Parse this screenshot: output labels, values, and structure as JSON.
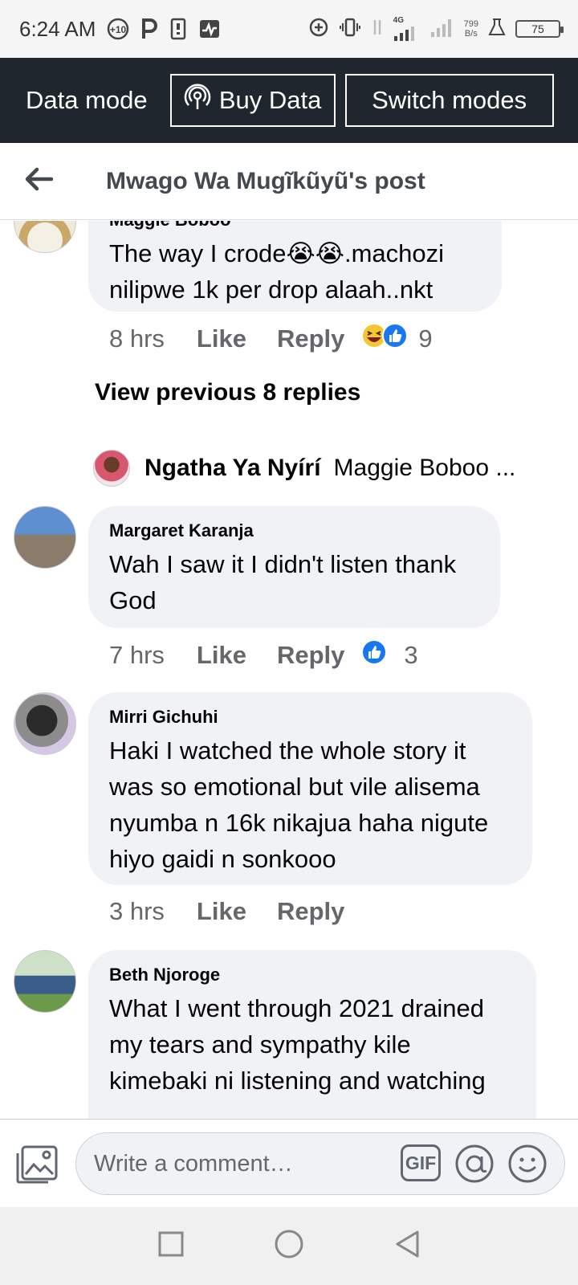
{
  "status_bar": {
    "time": "6:24 AM",
    "net_type": "4G",
    "net_speed_value": "799",
    "net_speed_unit": "B/s",
    "battery": "75"
  },
  "data_mode": {
    "label": "Data mode",
    "buy_label": "Buy Data",
    "switch_label": "Switch modes"
  },
  "header": {
    "title": "Mwago Wa Mugĩkũyũ's post"
  },
  "comments": [
    {
      "author": "Maggie Boboo",
      "text": "The  way I crode😭😭.machozi nilipwe 1k per drop alaah..nkt",
      "time": "8 hrs",
      "like": "Like",
      "reply": "Reply",
      "reaction_count": "9"
    },
    {
      "author": "Margaret Karanja",
      "text": "Wah I saw it I didn't listen thank God",
      "time": "7 hrs",
      "like": "Like",
      "reply": "Reply",
      "reaction_count": "3"
    },
    {
      "author": "Mirri Gichuhi",
      "text": "Haki I watched the whole story it was so emotional but vile alisema nyumba n 16k nikajua haha nigute hiyo gaidi n sonkooo",
      "time": "3 hrs",
      "like": "Like",
      "reply": "Reply"
    },
    {
      "author": "Beth Njoroge",
      "text": "What I went through 2021 drained my tears and sympathy kile kimebaki ni listening and watching"
    }
  ],
  "replies_link": "View previous 8 replies",
  "reply_preview": {
    "name": "Ngatha Ya Nyírí",
    "text": "Maggie Boboo ..."
  },
  "composer": {
    "placeholder": "Write a comment…",
    "gif_label": "GIF"
  },
  "colors": {
    "data_bar": "#1f262e",
    "bubble": "#f0f2f5",
    "meta_text": "#65676b",
    "like_blue": "#1877f2"
  }
}
